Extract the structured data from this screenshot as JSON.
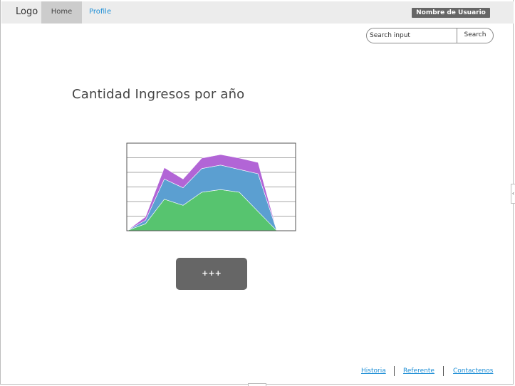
{
  "header": {
    "logo": "Logo",
    "nav": [
      {
        "label": "Home",
        "active": true
      },
      {
        "label": "Profile",
        "active": false
      }
    ],
    "user_button": "Nombre de Usuario"
  },
  "search": {
    "placeholder": "Search input",
    "button_label": "Search"
  },
  "main": {
    "title": "Cantidad Ingresos por año",
    "action_button": "+++"
  },
  "chart_data": {
    "type": "area",
    "stacked": true,
    "title": "",
    "xlabel": "",
    "ylabel": "",
    "grid": true,
    "ylim": [
      0,
      100
    ],
    "x": [
      0,
      1,
      2,
      3,
      4,
      5,
      6,
      7,
      8,
      9
    ],
    "series": [
      {
        "color": "#57c46f",
        "values": [
          0,
          8,
          36,
          29,
          44,
          47,
          44,
          22,
          0,
          0
        ]
      },
      {
        "color": "#5b9fd1",
        "values": [
          0,
          4,
          23,
          20,
          27,
          28,
          26,
          43,
          0,
          0
        ]
      },
      {
        "color": "#b265d6",
        "values": [
          0,
          4,
          13,
          10,
          12,
          12,
          13,
          13,
          0,
          0
        ]
      }
    ]
  },
  "footer": {
    "links": [
      "Historia",
      "Referente",
      "Contactenos"
    ]
  },
  "colors": {
    "link": "#1f8fd6",
    "topbar": "#ececec",
    "active_tab": "#cccccc",
    "button": "#666666"
  }
}
